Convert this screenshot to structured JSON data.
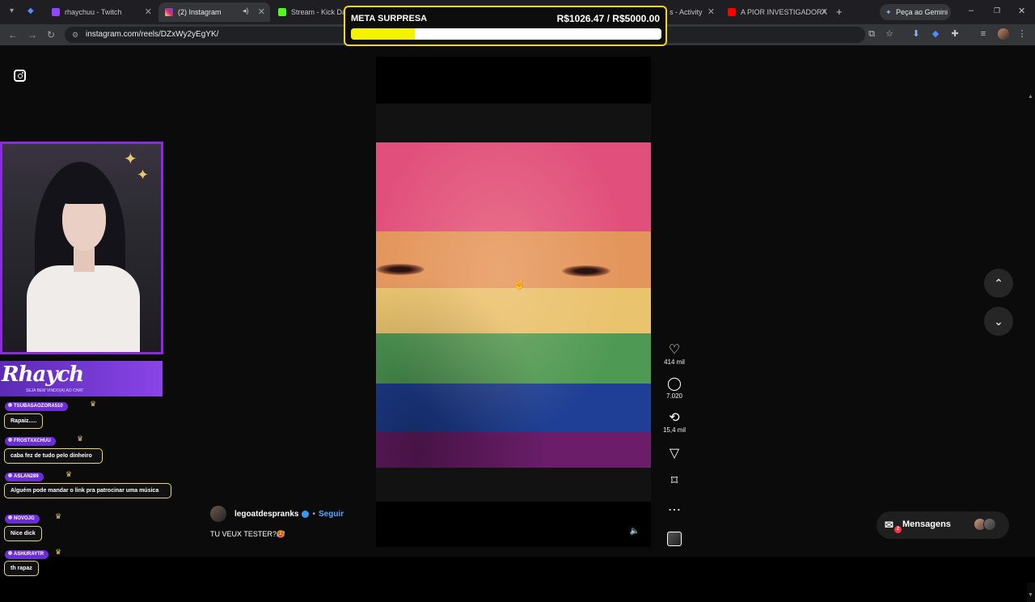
{
  "browser": {
    "tabs": [
      {
        "title": "rhaychuu - Twitch",
        "active": false
      },
      {
        "title": "(2) Instagram",
        "active": true
      },
      {
        "title": "Stream - Kick Dash",
        "active": false
      },
      {
        "title": "s - Activity",
        "active": false
      },
      {
        "title": "A PIOR INVESTIGADORA",
        "active": false
      }
    ],
    "gemini_label": "Peça ao Gemini",
    "url": "instagram.com/reels/DZxWy2yEgYK/"
  },
  "goal": {
    "title": "META SURPRESA",
    "amount": "R$1026.47 / R$5000.00",
    "progress": 0.205
  },
  "instagram": {
    "reel": {
      "flag_colors": [
        "#e1507c",
        "#e3955b",
        "#e9c36d",
        "#4e9a54",
        "#1e3f95",
        "#6b1d6a"
      ],
      "likes": "414 mil",
      "comments": "7.020",
      "reposts": "15,4 mil"
    },
    "author": {
      "name": "legoatdespranks",
      "follow": "Seguir",
      "caption": "TU VEUX TESTER?🥵"
    },
    "messages": {
      "label": "Mensagens",
      "badge": "2"
    }
  },
  "stream": {
    "banner_title": "Rhaych",
    "banner_sub": "SEJA BEM VINDO(A) AO CHAT",
    "chat": [
      {
        "user": "TSUBASAOZORA510",
        "message": "Rapaiz....."
      },
      {
        "user": "FROSTXXCHUU",
        "message": "caba fez de tudo pelo dinheiro"
      },
      {
        "user": "ASLAN289",
        "message": "Alguém pode mandar o link pra patrocinar uma música"
      },
      {
        "user": "NOVOJG",
        "message": "Nice dick"
      },
      {
        "user": "ASHURAYTR",
        "message": "th rapaz"
      }
    ]
  }
}
